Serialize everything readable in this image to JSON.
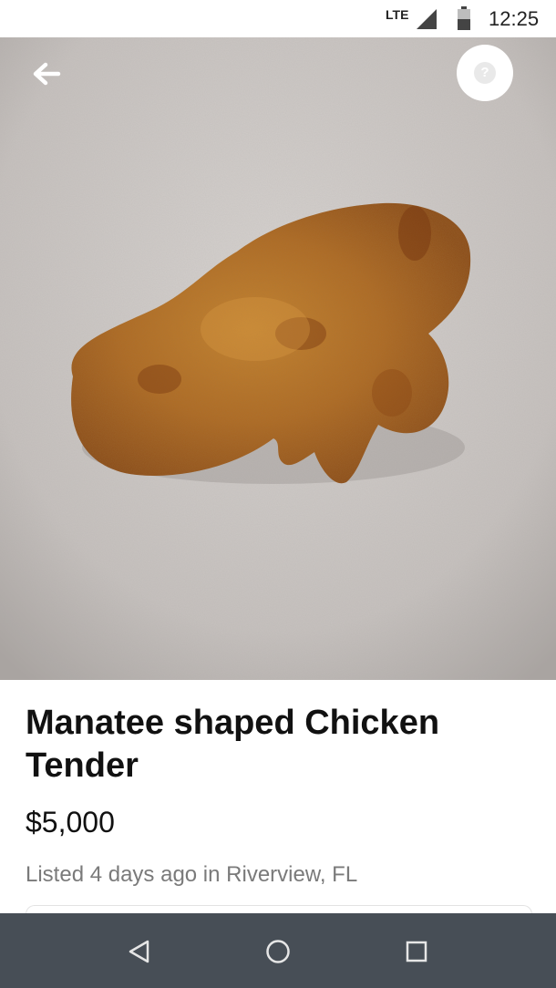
{
  "status_bar": {
    "network": "LTE",
    "time": "12:25",
    "icons": [
      "signal-icon",
      "battery-icon"
    ]
  },
  "photo": {
    "description_icon": "listing-photo",
    "back_icon": "arrow-left-icon",
    "help_icon": "question-icon",
    "help_glyph": "?"
  },
  "listing": {
    "title": "Manatee shaped Chicken Tender",
    "price": "$5,000",
    "listed_info": "Listed 4 days ago in Riverview, FL"
  },
  "nav_bar": {
    "buttons": [
      "back-triangle-icon",
      "home-circle-icon",
      "recents-square-icon"
    ]
  },
  "colors": {
    "nav_bg": "#474e56",
    "text_primary": "#111111",
    "text_secondary": "#7a7a7a",
    "surface": "#c9c5c2"
  }
}
